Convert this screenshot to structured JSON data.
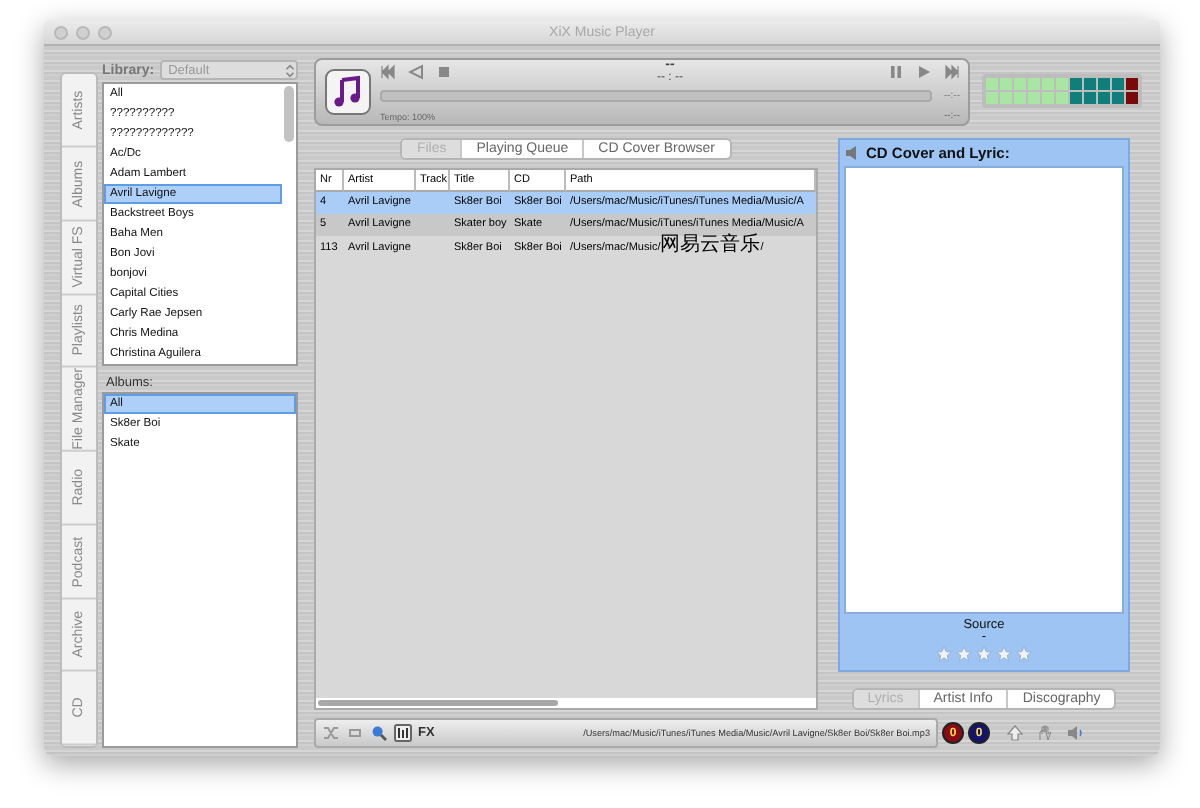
{
  "window": {
    "title": "XiX Music Player"
  },
  "side_tabs": [
    {
      "label": "Artists"
    },
    {
      "label": "Albums"
    },
    {
      "label": "Virtual FS"
    },
    {
      "label": "Playlists"
    },
    {
      "label": "File Manager"
    },
    {
      "label": "Radio"
    },
    {
      "label": "Podcast"
    },
    {
      "label": "Archive"
    },
    {
      "label": "CD"
    }
  ],
  "library": {
    "label": "Library:",
    "value": "Default"
  },
  "artists": [
    {
      "name": "All",
      "selected": false
    },
    {
      "name": "??????????",
      "selected": false
    },
    {
      "name": "?????????????",
      "selected": false
    },
    {
      "name": "Ac/Dc",
      "selected": false
    },
    {
      "name": "Adam Lambert",
      "selected": false
    },
    {
      "name": "Avril Lavigne",
      "selected": true
    },
    {
      "name": "Backstreet Boys",
      "selected": false
    },
    {
      "name": "Baha Men",
      "selected": false
    },
    {
      "name": "Bon Jovi",
      "selected": false
    },
    {
      "name": "bonjovi",
      "selected": false
    },
    {
      "name": "Capital Cities",
      "selected": false
    },
    {
      "name": "Carly Rae Jepsen",
      "selected": false
    },
    {
      "name": "Chris Medina",
      "selected": false
    },
    {
      "name": "Christina Aguilera",
      "selected": false
    }
  ],
  "albums_label": "Albums:",
  "albums": [
    {
      "name": "All",
      "selected": true
    },
    {
      "name": "Sk8er Boi",
      "selected": false
    },
    {
      "name": "Skate",
      "selected": false
    }
  ],
  "player": {
    "time": "--",
    "counter": "-- : --",
    "tempo": "Tempo: 100%",
    "total": "--:--",
    "position": "--:--"
  },
  "view_tabs": [
    {
      "label": "Files",
      "selected": true
    },
    {
      "label": "Playing Queue",
      "selected": false
    },
    {
      "label": "CD Cover Browser",
      "selected": false
    }
  ],
  "table": {
    "columns": [
      "Nr",
      "Artist",
      "Track",
      "Title",
      "CD",
      "Path"
    ],
    "rows": [
      {
        "nr": "4",
        "artist": "Avril Lavigne",
        "title": "Sk8er Boi",
        "cd": "Sk8er Boi",
        "path": "/Users/mac/Music/iTunes/iTunes Media/Music/A",
        "selected": true
      },
      {
        "nr": "5",
        "artist": "Avril Lavigne",
        "title": "Skater boy",
        "cd": "Skate",
        "path": "/Users/mac/Music/iTunes/iTunes Media/Music/A",
        "selected": false
      },
      {
        "nr": "113",
        "artist": "Avril Lavigne",
        "title": "Sk8er Boi",
        "cd": "Sk8er Boi",
        "path": "/Users/mac/Music/网易云音乐/",
        "selected": false
      }
    ]
  },
  "cover_panel": {
    "title": "CD Cover and Lyric:",
    "source_label": "Source",
    "source_value": "-",
    "stars": 0
  },
  "info_tabs": [
    {
      "label": "Lyrics",
      "selected": true
    },
    {
      "label": "Artist Info",
      "selected": false
    },
    {
      "label": "Discography",
      "selected": false
    }
  ],
  "status_bar": {
    "fx": "FX",
    "path": "/Users/mac/Music/iTunes/iTunes Media/Music/Avril Lavigne/Sk8er Boi/Sk8er Boi.mp3",
    "badges": [
      {
        "text": "0",
        "color": "#8b0a14"
      },
      {
        "text": "0",
        "color": "#14146e"
      }
    ]
  }
}
